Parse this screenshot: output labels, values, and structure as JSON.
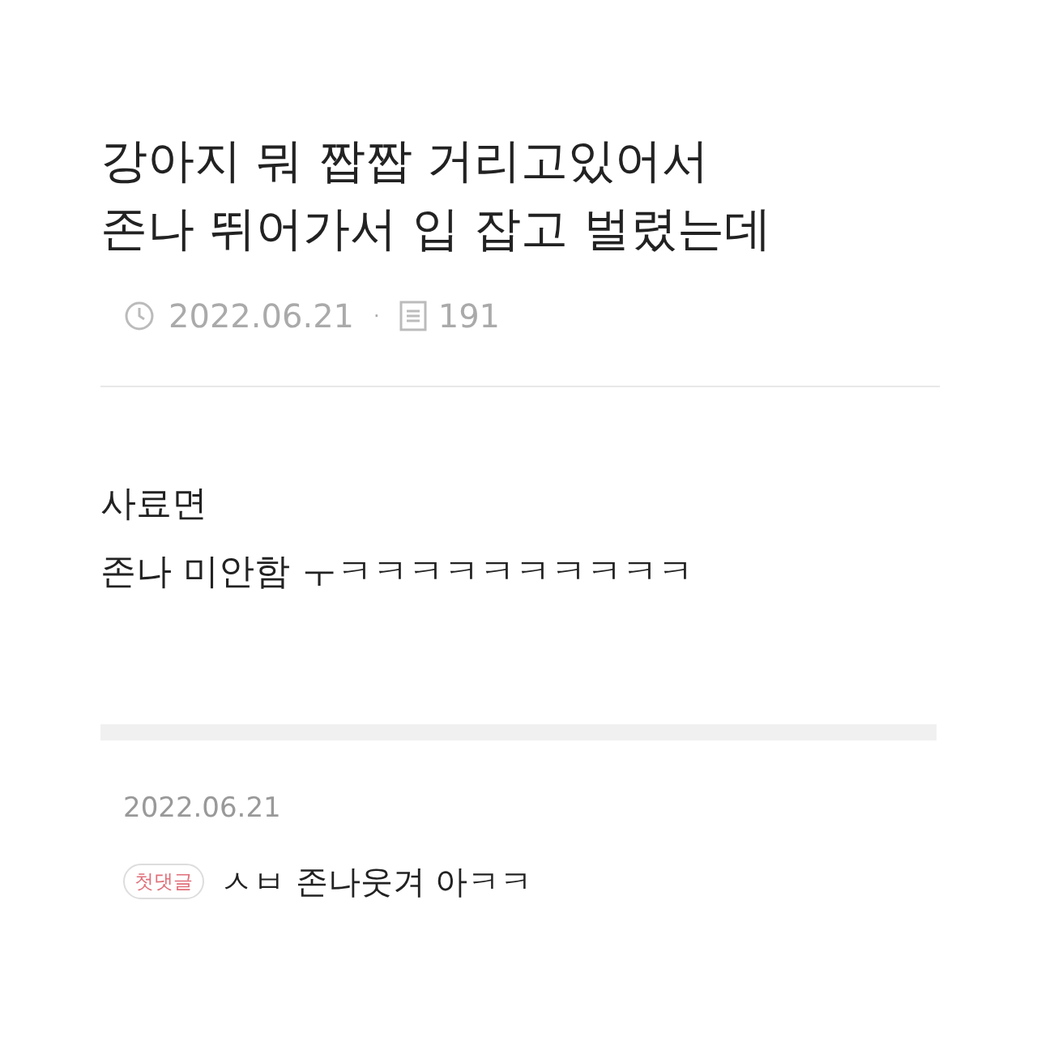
{
  "post": {
    "title_lines": [
      "강아지 뭐 짭짭 거리고있어서",
      "존나 뛰어가서 입 잡고 벌렸는데"
    ],
    "date": "2022.06.21",
    "separator": "·",
    "views": "191",
    "body_lines": [
      "사료면",
      "존나 미안함 ㅜㅋㅋㅋㅋㅋㅋㅋㅋㅋㅋ"
    ]
  },
  "comments": [
    {
      "date": "2022.06.21",
      "badge": "첫댓글",
      "text": "ㅅㅂ 존나웃겨 아ㅋㅋ"
    }
  ]
}
